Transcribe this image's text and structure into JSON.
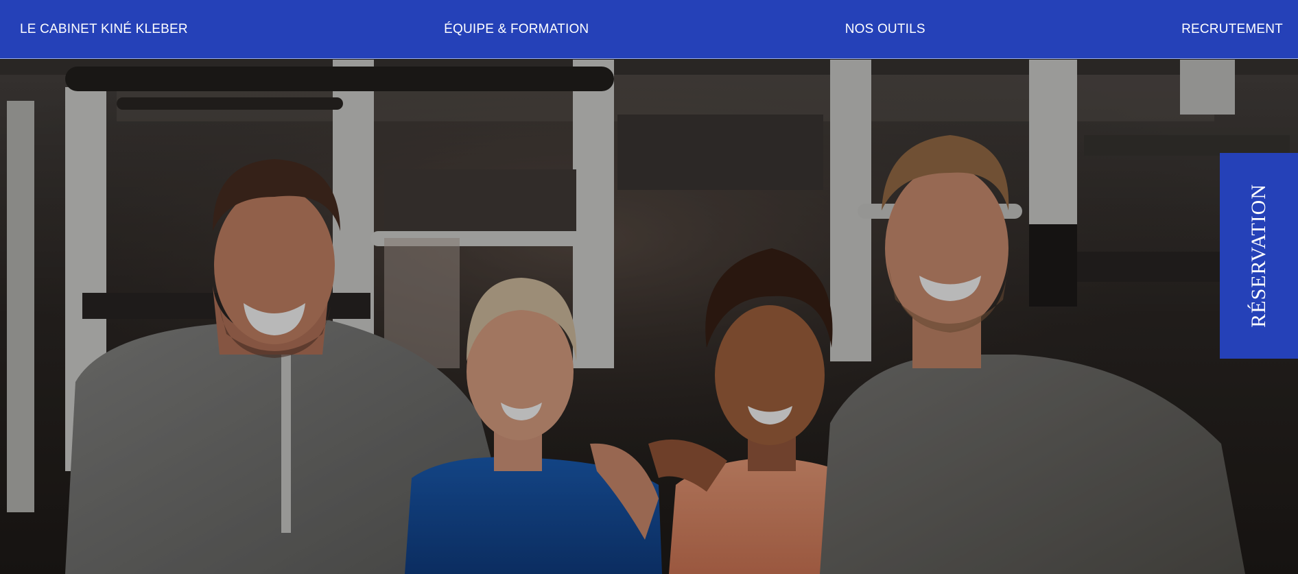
{
  "nav": {
    "items": [
      {
        "label": "LE CABINET KINÉ KLEBER"
      },
      {
        "label": "ÉQUIPE & FORMATION"
      },
      {
        "label": "NOS OUTILS"
      },
      {
        "label": "RECRUTEMENT"
      }
    ],
    "background_color": "#2541b8"
  },
  "hero": {
    "image_description_icon": "team-photo"
  },
  "reservation": {
    "label": "RÉSERVATION",
    "background_color": "#2541b8"
  }
}
